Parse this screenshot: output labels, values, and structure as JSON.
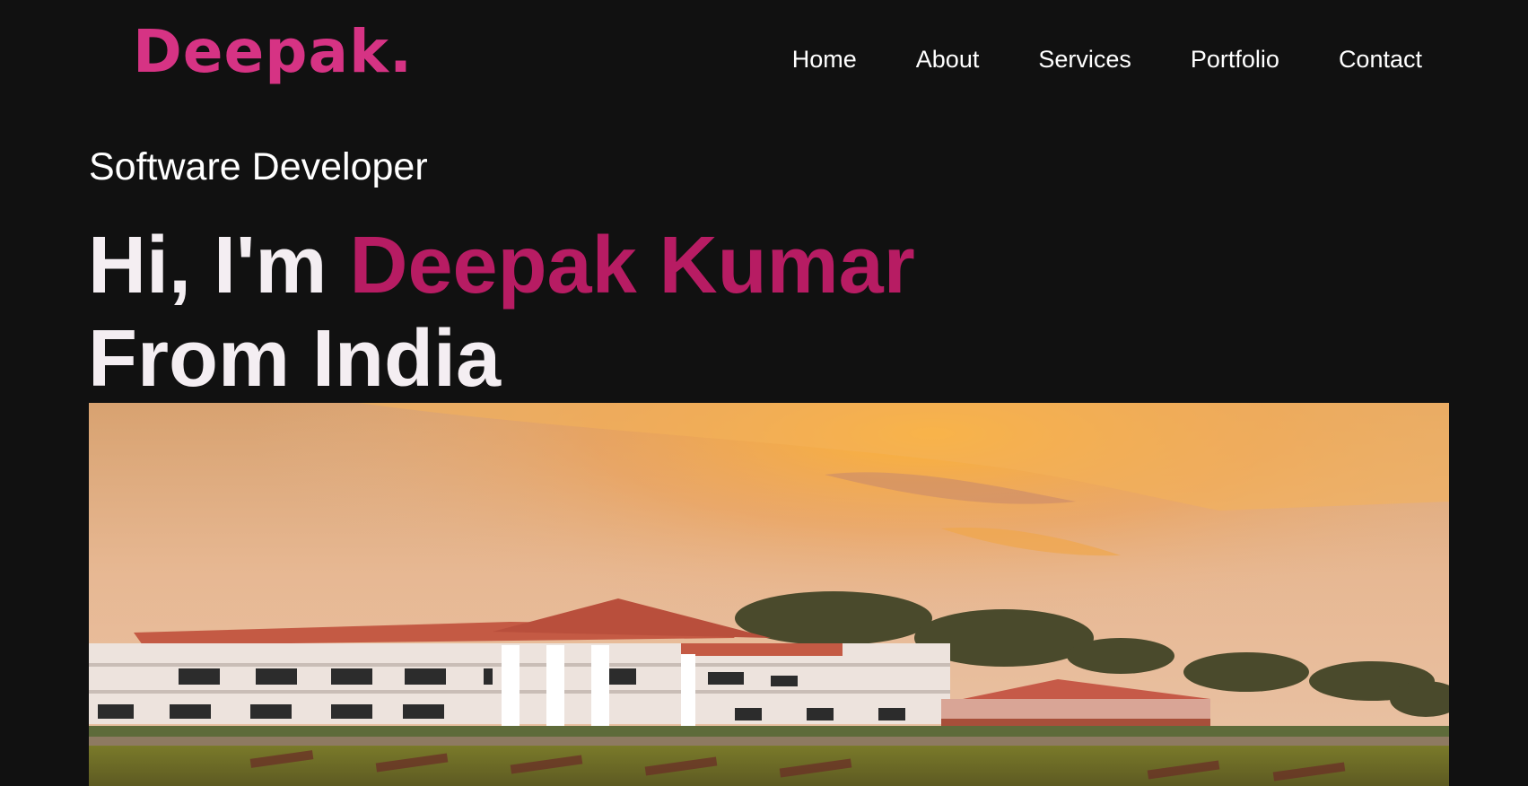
{
  "logo": "Deepak.",
  "nav": {
    "home": "Home",
    "about": "About",
    "services": "Services",
    "portfolio": "Portfolio",
    "contact": "Contact"
  },
  "hero": {
    "role": "Software Developer",
    "greeting": "Hi, I'm",
    "name": "Deepak Kumar",
    "origin": "From India"
  },
  "colors": {
    "background": "#111111",
    "accent_logo": "#d63384",
    "accent_name": "#b71c63",
    "text": "#ffffff"
  }
}
